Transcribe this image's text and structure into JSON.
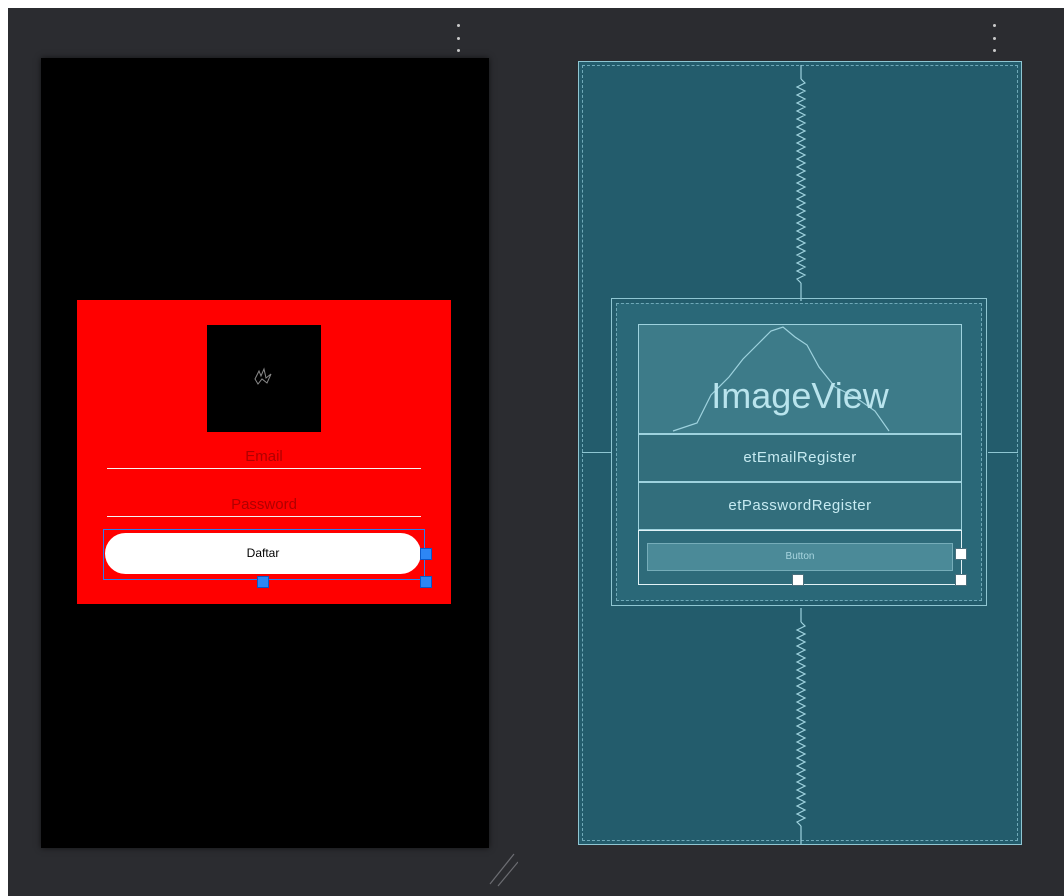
{
  "design_view": {
    "email_hint": "Email",
    "password_hint": "Password",
    "button_label": "Daftar",
    "container_color": "#ff0000",
    "selection_color": "#2d86f5"
  },
  "blueprint_view": {
    "imageview_label": "ImageView",
    "email_id": "etEmailRegister",
    "password_id": "etPasswordRegister",
    "button_label": "Button",
    "background_color": "#235c6c"
  },
  "icons": {
    "menu": "more-vert-icon",
    "broken_image": "broken-image-icon",
    "resize": "resize-grip-icon"
  }
}
